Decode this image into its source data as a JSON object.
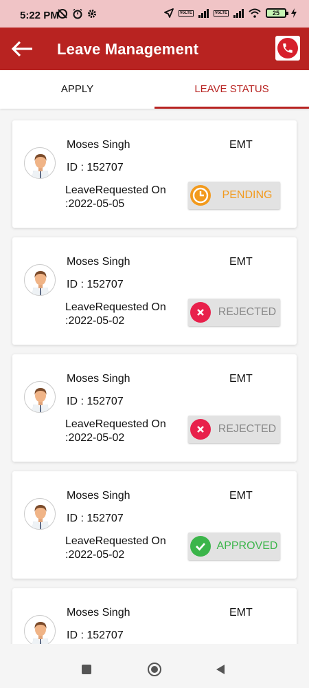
{
  "status_bar": {
    "time": "5:22 PM",
    "battery": "25"
  },
  "app_bar": {
    "title": "Leave Management"
  },
  "tabs": [
    {
      "label": "APPLY",
      "active": false
    },
    {
      "label": "LEAVE STATUS",
      "active": true
    }
  ],
  "colors": {
    "brand": "#b82321",
    "pending": "#f29a1d",
    "pending_text": "#f29a1d",
    "rejected": "#e8204b",
    "rejected_text": "#8a8a8a",
    "approved": "#3bb54a",
    "approved_text": "#3bb54a"
  },
  "leaves": [
    {
      "name": "Moses Singh",
      "role": "EMT",
      "id_text": "ID : 152707",
      "req_label": "LeaveRequested On",
      "req_date": ":2022-05-05",
      "status": "PENDING",
      "status_type": "pending"
    },
    {
      "name": "Moses Singh",
      "role": "EMT",
      "id_text": "ID : 152707",
      "req_label": "LeaveRequested On",
      "req_date": ":2022-05-02",
      "status": "REJECTED",
      "status_type": "rejected"
    },
    {
      "name": "Moses Singh",
      "role": "EMT",
      "id_text": "ID : 152707",
      "req_label": "LeaveRequested On",
      "req_date": ":2022-05-02",
      "status": "REJECTED",
      "status_type": "rejected"
    },
    {
      "name": "Moses Singh",
      "role": "EMT",
      "id_text": "ID : 152707",
      "req_label": "LeaveRequested On",
      "req_date": ":2022-05-02",
      "status": "APPROVED",
      "status_type": "approved"
    },
    {
      "name": "Moses Singh",
      "role": "EMT",
      "id_text": "ID : 152707",
      "req_label": "",
      "req_date": "",
      "status": "",
      "status_type": ""
    }
  ]
}
